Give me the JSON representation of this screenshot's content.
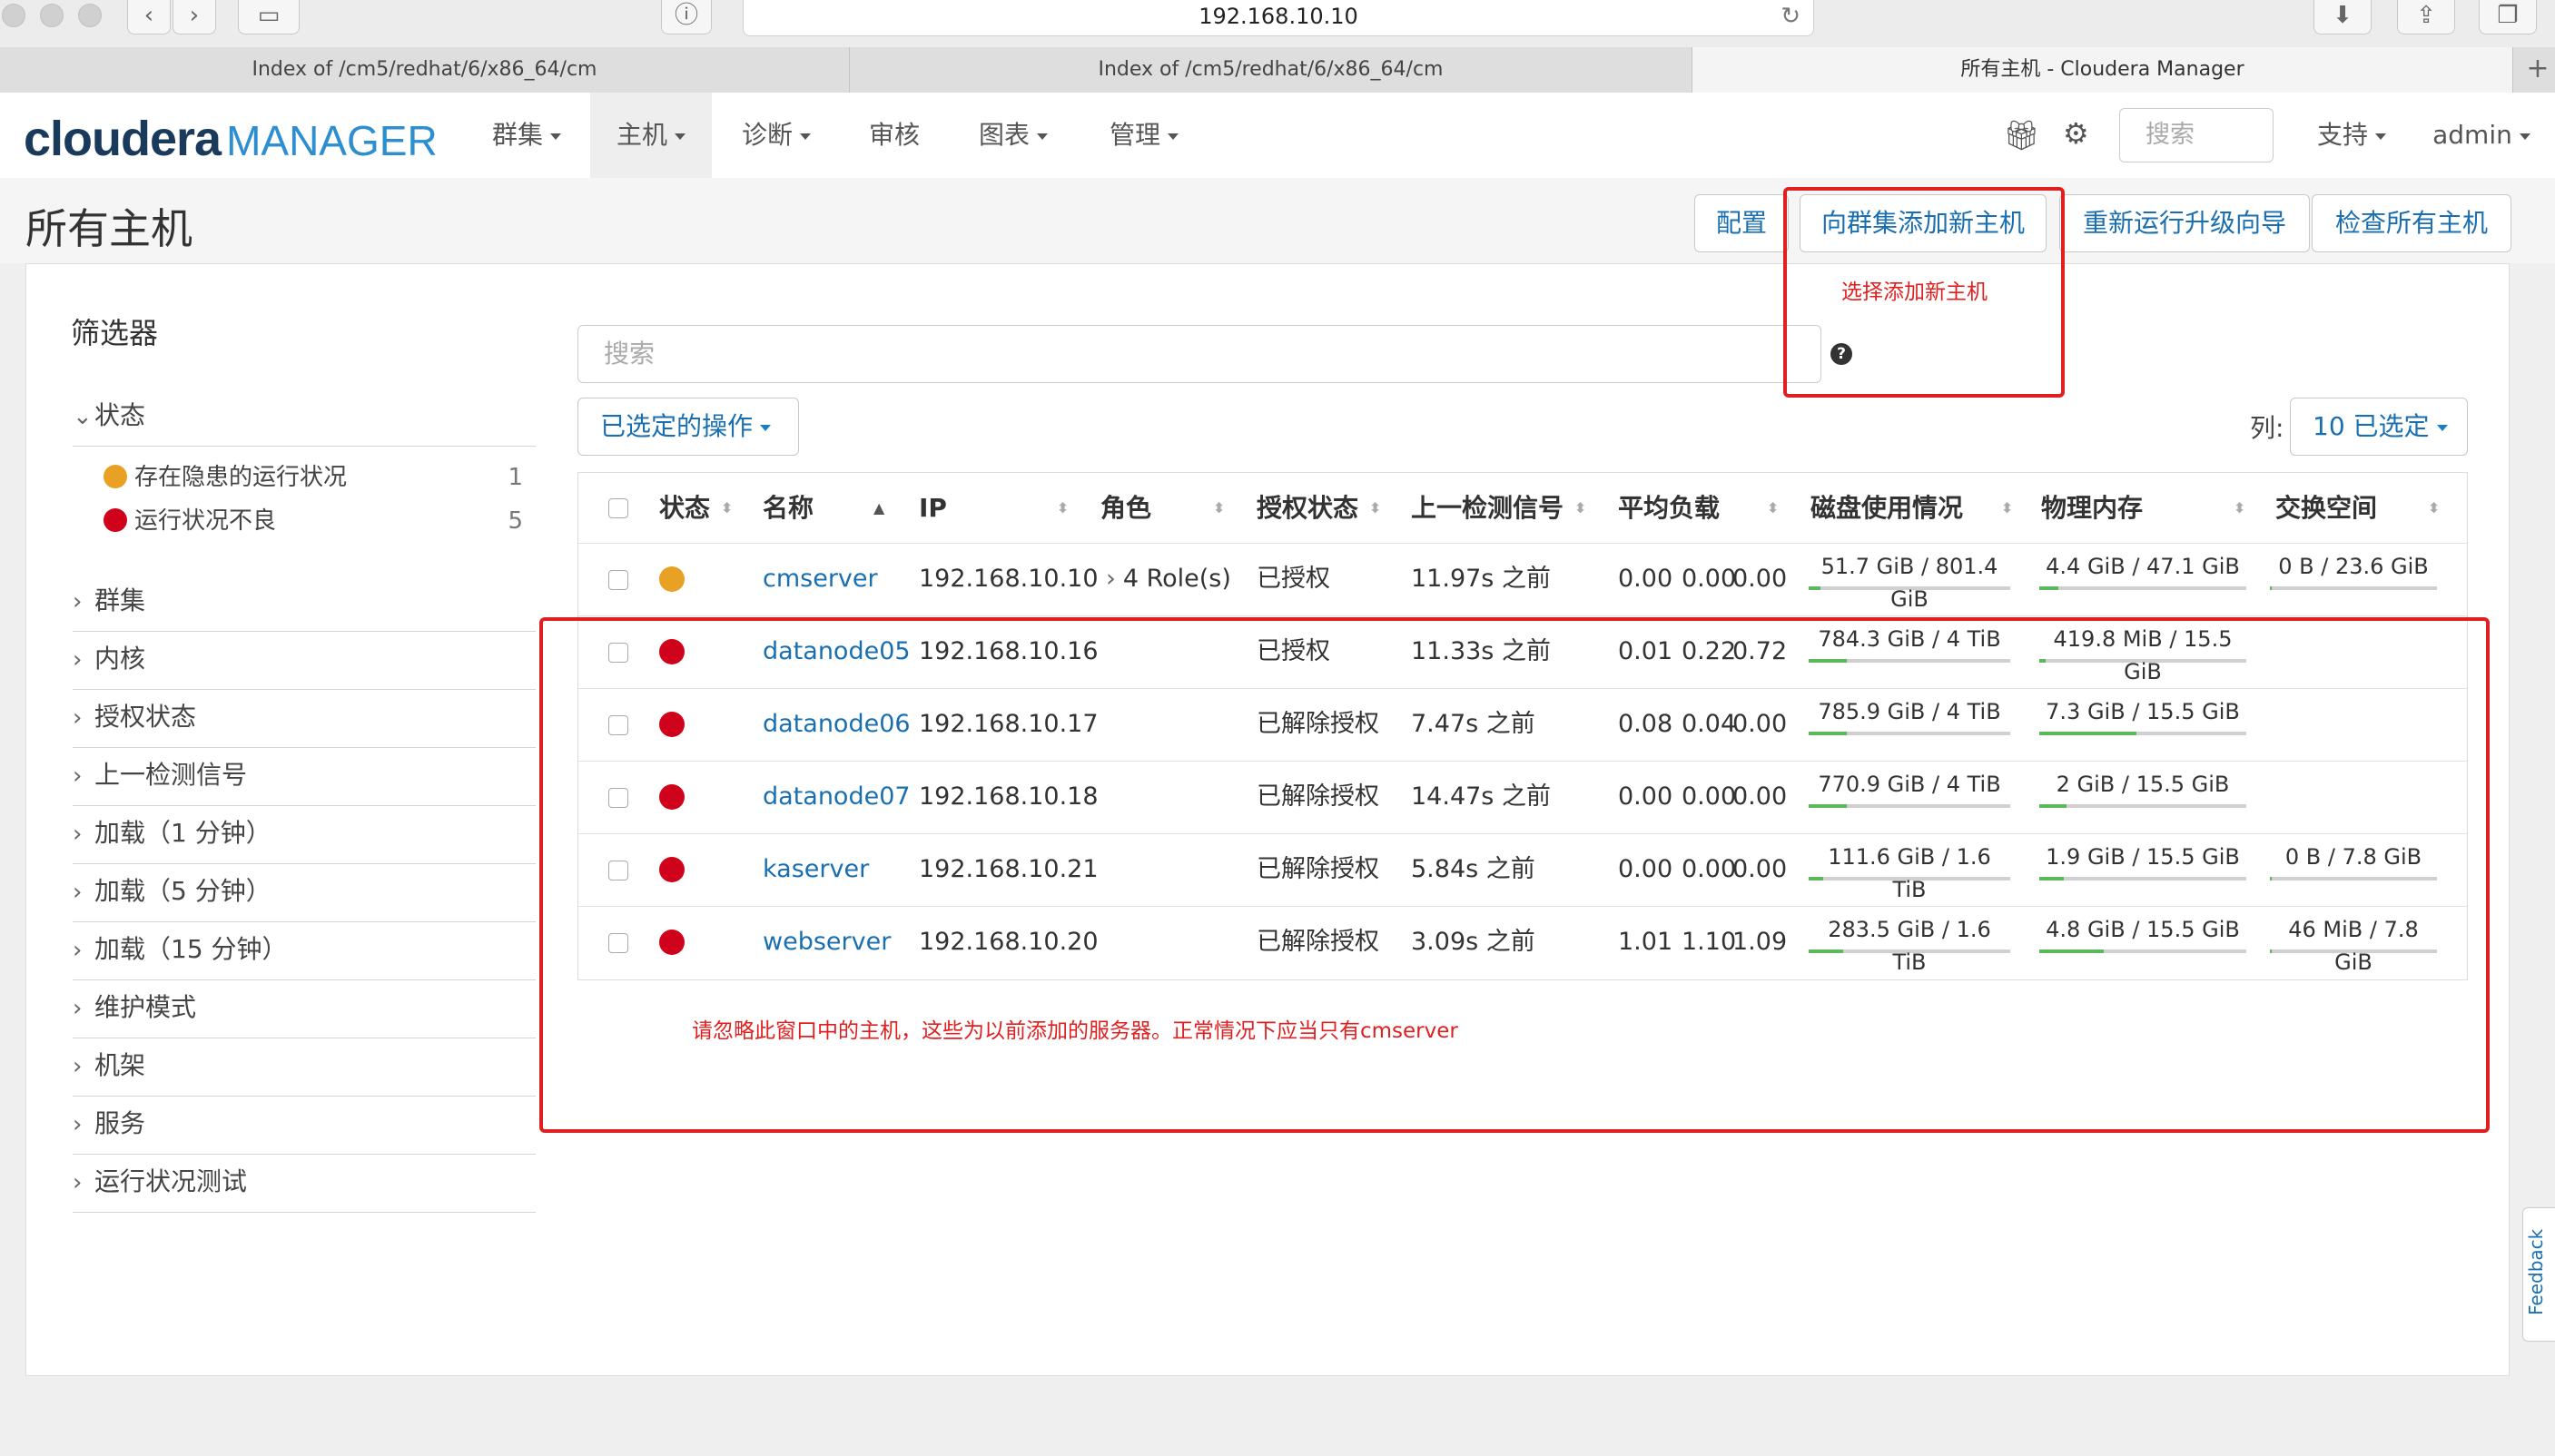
{
  "browser": {
    "address": "192.168.10.10",
    "tabs": [
      {
        "label": "Index of /cm5/redhat/6/x86_64/cm"
      },
      {
        "label": "Index of /cm5/redhat/6/x86_64/cm"
      },
      {
        "label": "所有主机 - Cloudera Manager"
      }
    ],
    "new_tab": "+"
  },
  "brand": {
    "cloudera": "cloudera",
    "manager": "MANAGER"
  },
  "nav": {
    "items": [
      {
        "label": "群集",
        "dropdown": true
      },
      {
        "label": "主机",
        "dropdown": true,
        "active": true
      },
      {
        "label": "诊断",
        "dropdown": true
      },
      {
        "label": "审核",
        "dropdown": false
      },
      {
        "label": "图表",
        "dropdown": true
      },
      {
        "label": "管理",
        "dropdown": true
      }
    ],
    "search_placeholder": "搜索",
    "support": "支持",
    "user": "admin"
  },
  "page": {
    "title": "所有主机",
    "buttons": {
      "config": "配置",
      "add_host": "向群集添加新主机",
      "rerun_wizard": "重新运行升级向导",
      "inspect_all": "检查所有主机"
    }
  },
  "filters": {
    "title": "筛选器",
    "status_header": "状态",
    "status_options": [
      {
        "label": "存在隐患的运行状况",
        "count": "1",
        "color": "#e8a125"
      },
      {
        "label": "运行状况不良",
        "count": "5",
        "color": "#d0021b"
      }
    ],
    "groups": [
      "群集",
      "内核",
      "授权状态",
      "上一检测信号",
      "加载（1 分钟）",
      "加载（5 分钟）",
      "加载（15 分钟）",
      "维护模式",
      "机架",
      "服务",
      "运行状况测试"
    ]
  },
  "table_tools": {
    "search_placeholder": "搜索",
    "help": "?",
    "actions": "已选定的操作",
    "columns_label": "列:",
    "columns_selected": "10 已选定"
  },
  "table": {
    "columns": [
      "状态",
      "名称",
      "IP",
      "角色",
      "授权状态",
      "上一检测信号",
      "平均负载",
      "磁盘使用情况",
      "物理内存",
      "交换空间"
    ],
    "rows": [
      {
        "status": "concerning",
        "color": "#e8a125",
        "name": "cmserver",
        "ip": "192.168.10.10",
        "roles": "4 Role(s)",
        "auth": "已授权",
        "heartbeat": "11.97s 之前",
        "load": [
          "0.00",
          "0.00",
          "0.00"
        ],
        "disk": "51.7 GiB / 801.4 GiB",
        "disk_pct": 6,
        "mem": "4.4 GiB / 47.1 GiB",
        "mem_pct": 9,
        "swap": "0 B / 23.6 GiB",
        "swap_pct": 0
      },
      {
        "status": "bad",
        "color": "#d0021b",
        "name": "datanode05",
        "ip": "192.168.10.16",
        "roles": "",
        "auth": "已授权",
        "heartbeat": "11.33s 之前",
        "load": [
          "0.01",
          "0.22",
          "0.72"
        ],
        "disk": "784.3 GiB / 4 TiB",
        "disk_pct": 19,
        "mem": "419.8 MiB / 15.5 GiB",
        "mem_pct": 3,
        "swap": "",
        "swap_pct": null
      },
      {
        "status": "bad",
        "color": "#d0021b",
        "name": "datanode06",
        "ip": "192.168.10.17",
        "roles": "",
        "auth": "已解除授权",
        "heartbeat": "7.47s 之前",
        "load": [
          "0.08",
          "0.04",
          "0.00"
        ],
        "disk": "785.9 GiB / 4 TiB",
        "disk_pct": 19,
        "mem": "7.3 GiB / 15.5 GiB",
        "mem_pct": 47,
        "swap": "",
        "swap_pct": null
      },
      {
        "status": "bad",
        "color": "#d0021b",
        "name": "datanode07",
        "ip": "192.168.10.18",
        "roles": "",
        "auth": "已解除授权",
        "heartbeat": "14.47s 之前",
        "load": [
          "0.00",
          "0.00",
          "0.00"
        ],
        "disk": "770.9 GiB / 4 TiB",
        "disk_pct": 19,
        "mem": "2 GiB / 15.5 GiB",
        "mem_pct": 13,
        "swap": "",
        "swap_pct": null
      },
      {
        "status": "bad",
        "color": "#d0021b",
        "name": "kaserver",
        "ip": "192.168.10.21",
        "roles": "",
        "auth": "已解除授权",
        "heartbeat": "5.84s 之前",
        "load": [
          "0.00",
          "0.00",
          "0.00"
        ],
        "disk": "111.6 GiB / 1.6 TiB",
        "disk_pct": 7,
        "mem": "1.9 GiB / 15.5 GiB",
        "mem_pct": 12,
        "swap": "0 B / 7.8 GiB",
        "swap_pct": 0
      },
      {
        "status": "bad",
        "color": "#d0021b",
        "name": "webserver",
        "ip": "192.168.10.20",
        "roles": "",
        "auth": "已解除授权",
        "heartbeat": "3.09s 之前",
        "load": [
          "1.01",
          "1.10",
          "1.09"
        ],
        "disk": "283.5 GiB / 1.6 TiB",
        "disk_pct": 17,
        "mem": "4.8 GiB / 15.5 GiB",
        "mem_pct": 31,
        "swap": "46 MiB / 7.8 GiB",
        "swap_pct": 1
      }
    ]
  },
  "annotations": {
    "add_host_note": "选择添加新主机",
    "ignore_note": "请忽略此窗口中的主机，这些为以前添加的服务器。正常情况下应当只有cmserver"
  },
  "feedback": "Feedback",
  "colors": {
    "link": "#1a6fb0",
    "annotation": "#e02020",
    "bar_fill": "#5cb85c"
  }
}
